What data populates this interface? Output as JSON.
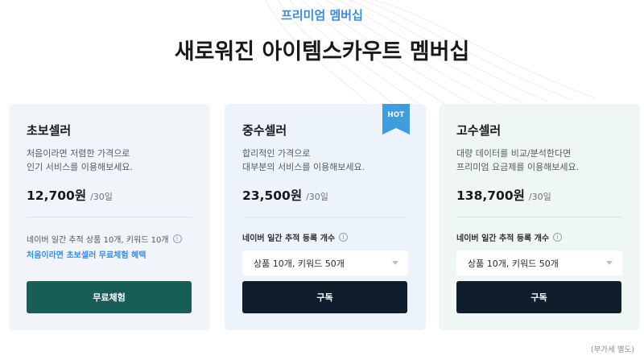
{
  "header": {
    "eyebrow": "프리미엄 멤버십",
    "title": "새로워진 아이템스카우트 멤버십"
  },
  "plans": [
    {
      "name": "초보셀러",
      "desc_line1": "처음이라면 저렴한 가격으로",
      "desc_line2": "인기 서비스를 이용해보세요.",
      "price": "12,700원",
      "period": "/30일",
      "feature": "네이버 일간 추적 상품 10개, 키워드 10개",
      "promo": "처음이라면 초보셀러 무료체험 혜택",
      "button": "무료체험"
    },
    {
      "name": "중수셀러",
      "badge": "HOT",
      "desc_line1": "합리적인 가격으로",
      "desc_line2": "대부분의 서비스를 이용해보세요.",
      "price": "23,500원",
      "period": "/30일",
      "feature_label": "네이버 일간 추적 등록 개수",
      "select_value": "상품 10개, 키워드 50개",
      "button": "구독"
    },
    {
      "name": "고수셀러",
      "desc_line1": "대량 데이터를 비교/분석한다면",
      "desc_line2": "프리미엄 요금제를 이용해보세요.",
      "price": "138,700원",
      "period": "/30일",
      "feature_label": "네이버 일간 추적 등록 개수",
      "select_value": "상품 10개, 키워드 50개",
      "button": "구독"
    }
  ],
  "footer": {
    "vat_note": "(부가세 별도)"
  },
  "icons": {
    "info": "info-icon",
    "dropdown": "chevron-down-icon",
    "badge": "hot-ribbon-icon"
  },
  "colors": {
    "accent": "#3b8be0",
    "trial_button": "#185e57",
    "subscribe_button": "#0f1d2c",
    "hot_badge": "#3f9ddf"
  }
}
